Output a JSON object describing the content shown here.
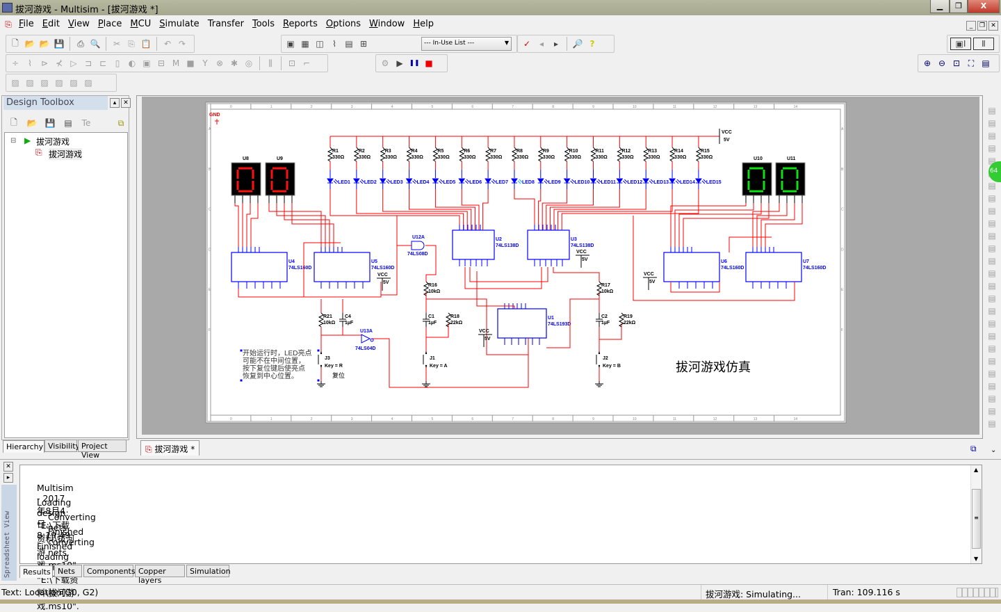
{
  "window": {
    "title": "拔河游戏 - Multisim - [拔河游戏 *]",
    "controls": [
      "minimize",
      "restore",
      "close"
    ]
  },
  "menu": [
    {
      "label": "File",
      "key": "F"
    },
    {
      "label": "Edit",
      "key": "E"
    },
    {
      "label": "View",
      "key": "V"
    },
    {
      "label": "Place",
      "key": "P"
    },
    {
      "label": "MCU",
      "key": "M"
    },
    {
      "label": "Simulate",
      "key": "S"
    },
    {
      "label": "Transfer",
      "key": "n"
    },
    {
      "label": "Tools",
      "key": "T"
    },
    {
      "label": "Reports",
      "key": "R"
    },
    {
      "label": "Options",
      "key": "O"
    },
    {
      "label": "Window",
      "key": "W"
    },
    {
      "label": "Help",
      "key": "H"
    }
  ],
  "toolbar": {
    "standard": [
      "new-icon",
      "open-icon",
      "open-sample-icon",
      "save-icon",
      "|",
      "print-icon",
      "print-preview-icon",
      "|",
      "cut-icon",
      "copy-icon",
      "paste-icon",
      "|",
      "undo-icon",
      "redo-icon"
    ],
    "view": [
      "toolbox-toggle-icon",
      "spreadsheet-toggle-icon",
      "database-icon",
      "grapher-icon",
      "postprocessor-icon",
      "component-wizard-icon",
      "|",
      "electrical-rules-icon",
      "netlist-icon"
    ],
    "in_use_list": "--- In-Use List ---",
    "tools": [
      "ercheck-icon",
      "back-annotate-icon",
      "forward-annotate-icon",
      "|",
      "find-examples-icon",
      "help-icon"
    ],
    "components": [
      "source-icon",
      "resistor-icon",
      "diode-icon",
      "transistor-icon",
      "analog-icon",
      "ttl-icon",
      "cmos-icon",
      "mcu-icon",
      "indicator-icon",
      "misc-digital-icon",
      "power-icon",
      "misc-icon",
      "advanced-peripherals-icon",
      "rf-icon",
      "electromechanical-icon",
      "ladder-icon",
      "mcu-module-icon",
      "|",
      "bus-icon",
      "|",
      "hierarchical-block-icon",
      "connector-icon"
    ],
    "simulation": [
      "interactive-icon",
      "run-icon",
      "pause-icon",
      "stop-icon"
    ],
    "graphics": [
      "line-icon",
      "polyline-icon",
      "rectangle-icon",
      "ellipse-icon",
      "arc-icon",
      "polygon-icon"
    ],
    "zoom": [
      "zoom-in-icon",
      "zoom-out-icon",
      "zoom-area-icon",
      "zoom-fit-icon",
      "full-screen-icon"
    ]
  },
  "toolbox": {
    "title": "Design Toolbox",
    "tree": [
      {
        "label": "拔河游戏",
        "type": "design"
      },
      {
        "label": "拔河游戏",
        "type": "sheet"
      }
    ],
    "tabs": [
      "Hierarchy",
      "Visibility",
      "Project View"
    ]
  },
  "document_tab": "拔河游戏 *",
  "schematic": {
    "gnd_label": "GND",
    "title_text": "拔河游戏仿真",
    "note": [
      "开始运行时，LED亮点",
      "可能不在中间位置，",
      "按下复位键后使亮点",
      "恢复到中心位置。"
    ],
    "reset_label": "复位",
    "grid_cols": [
      "0",
      "1",
      "2",
      "3",
      "4",
      "5",
      "6",
      "7",
      "8",
      "9",
      "10",
      "11",
      "12",
      "13",
      "14"
    ],
    "grid_rows": [
      "A",
      "B",
      "C",
      "D",
      "E",
      "F"
    ],
    "vcc": {
      "label": "VCC",
      "value": "5V"
    },
    "resistors": [
      {
        "ref": "R1",
        "value": "330Ω"
      },
      {
        "ref": "R2",
        "value": "330Ω"
      },
      {
        "ref": "R3",
        "value": "330Ω"
      },
      {
        "ref": "R4",
        "value": "330Ω"
      },
      {
        "ref": "R5",
        "value": "330Ω"
      },
      {
        "ref": "R6",
        "value": "330Ω"
      },
      {
        "ref": "R7",
        "value": "330Ω"
      },
      {
        "ref": "R8",
        "value": "330Ω"
      },
      {
        "ref": "R9",
        "value": "330Ω"
      },
      {
        "ref": "R10",
        "value": "330Ω"
      },
      {
        "ref": "R11",
        "value": "330Ω"
      },
      {
        "ref": "R12",
        "value": "330Ω"
      },
      {
        "ref": "R13",
        "value": "330Ω"
      },
      {
        "ref": "R14",
        "value": "330Ω"
      },
      {
        "ref": "R15",
        "value": "330Ω"
      }
    ],
    "leds": [
      "LED1",
      "LED2",
      "LED3",
      "LED4",
      "LED5",
      "LED6",
      "LED7",
      "LED8",
      "LED9",
      "LED10",
      "LED11",
      "LED12",
      "LED13",
      "LED14",
      "LED15"
    ],
    "lit_led": "LED8",
    "displays": [
      {
        "ref": "U8",
        "digit": "0",
        "color": "#ff1010"
      },
      {
        "ref": "U9",
        "digit": "0",
        "color": "#ff1010"
      },
      {
        "ref": "U10",
        "digit": "0",
        "color": "#10e010"
      },
      {
        "ref": "U11",
        "digit": "0",
        "color": "#10e010"
      }
    ],
    "ics": [
      {
        "ref": "U4",
        "part": "74LS160D"
      },
      {
        "ref": "U5",
        "part": "74LS160D"
      },
      {
        "ref": "U2",
        "part": "74LS138D"
      },
      {
        "ref": "U3",
        "part": "74LS138D"
      },
      {
        "ref": "U1",
        "part": "74LS193D"
      },
      {
        "ref": "U6",
        "part": "74LS160D"
      },
      {
        "ref": "U7",
        "part": "74LS160D"
      }
    ],
    "gates": [
      {
        "ref": "U12A",
        "part": "74LS08D"
      },
      {
        "ref": "U13A",
        "part": "74LS04D"
      }
    ],
    "passives": [
      {
        "ref": "R16",
        "value": "10kΩ"
      },
      {
        "ref": "R17",
        "value": "10kΩ"
      },
      {
        "ref": "R21",
        "value": "10kΩ"
      },
      {
        "ref": "C4",
        "value": "1µF"
      },
      {
        "ref": "C1",
        "value": "1µF"
      },
      {
        "ref": "R18",
        "value": "22kΩ"
      },
      {
        "ref": "C2",
        "value": "1µF"
      },
      {
        "ref": "R19",
        "value": "22kΩ"
      }
    ],
    "switches": [
      {
        "ref": "J3",
        "key": "Key = R"
      },
      {
        "ref": "J1",
        "key": "Key = A"
      },
      {
        "ref": "J2",
        "key": "Key = B"
      }
    ],
    "colors": {
      "wire": "#ff0000",
      "component": "#0000ff",
      "lit_led": "#00b0ff",
      "background": "#ffffff"
    }
  },
  "spreadsheet": {
    "side_label": "Spreadsheet View",
    "lines": [
      {
        "text": "Multisim  -  2017年8月4日, 8:19:49",
        "indent": false
      },
      {
        "text": "Loading design: \"E:\\下载资料\\拔河游戏.ms10\"",
        "indent": false
      },
      {
        "text": "Converting nets",
        "indent": true
      },
      {
        "text": "Finished converting nets.",
        "indent": true
      },
      {
        "text": "Finished loading design: \"E:\\下载资料\\拔河游戏.ms10\".",
        "indent": false
      }
    ],
    "tabs": [
      "Results",
      "Nets",
      "Components",
      "Copper layers",
      "Simulation"
    ],
    "active_tab": "Results"
  },
  "status": {
    "left": "Text: Location(G0, G2)",
    "sim": "拔河游戏: Simulating...",
    "tran": "Tran: 109.116 s"
  }
}
